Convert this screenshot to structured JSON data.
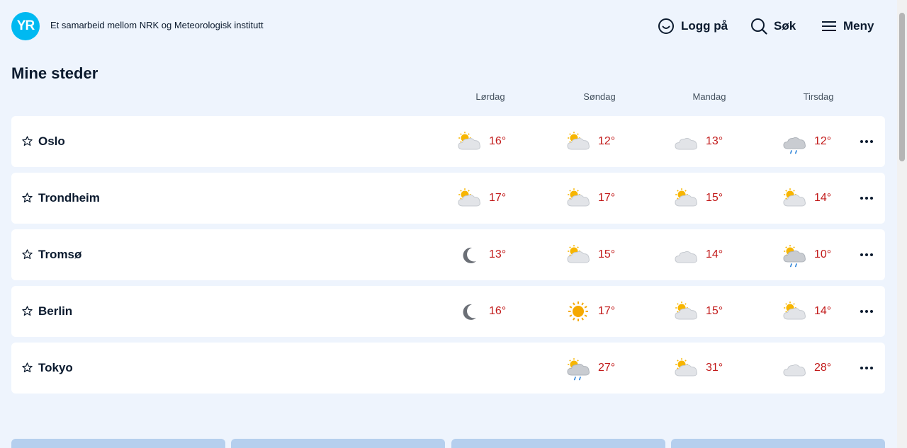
{
  "header": {
    "logo_text": "YR",
    "tagline": "Et samarbeid mellom NRK og Meteorologisk institutt",
    "login_label": "Logg på",
    "search_label": "Søk",
    "menu_label": "Meny"
  },
  "page_title": "Mine steder",
  "days": [
    "Lørdag",
    "Søndag",
    "Mandag",
    "Tirsdag"
  ],
  "locations": [
    {
      "name": "Oslo",
      "forecast": [
        {
          "icon": "partly-cloudy-icon",
          "temp": "16°"
        },
        {
          "icon": "partly-cloudy-icon",
          "temp": "12°"
        },
        {
          "icon": "cloud-icon",
          "temp": "13°"
        },
        {
          "icon": "rain-cloud-icon",
          "temp": "12°"
        }
      ]
    },
    {
      "name": "Trondheim",
      "forecast": [
        {
          "icon": "partly-cloudy-icon",
          "temp": "17°"
        },
        {
          "icon": "partly-cloudy-icon",
          "temp": "17°"
        },
        {
          "icon": "partly-cloudy-icon",
          "temp": "15°"
        },
        {
          "icon": "partly-cloudy-icon",
          "temp": "14°"
        }
      ]
    },
    {
      "name": "Tromsø",
      "forecast": [
        {
          "icon": "moon-icon",
          "temp": "13°"
        },
        {
          "icon": "partly-cloudy-icon",
          "temp": "15°"
        },
        {
          "icon": "cloud-icon",
          "temp": "14°"
        },
        {
          "icon": "sun-rain-cloud-icon",
          "temp": "10°"
        }
      ]
    },
    {
      "name": "Berlin",
      "forecast": [
        {
          "icon": "moon-icon",
          "temp": "16°"
        },
        {
          "icon": "sun-icon",
          "temp": "17°"
        },
        {
          "icon": "partly-cloudy-icon",
          "temp": "15°"
        },
        {
          "icon": "partly-cloudy-icon",
          "temp": "14°"
        }
      ]
    },
    {
      "name": "Tokyo",
      "forecast": [
        null,
        {
          "icon": "sun-rain-cloud-icon",
          "temp": "27°"
        },
        {
          "icon": "partly-cloudy-icon",
          "temp": "31°"
        },
        {
          "icon": "cloud-icon",
          "temp": "28°"
        }
      ]
    }
  ],
  "colors": {
    "background": "#eef4fd",
    "temperature": "#c21a1a",
    "logo": "#00b9f1"
  }
}
